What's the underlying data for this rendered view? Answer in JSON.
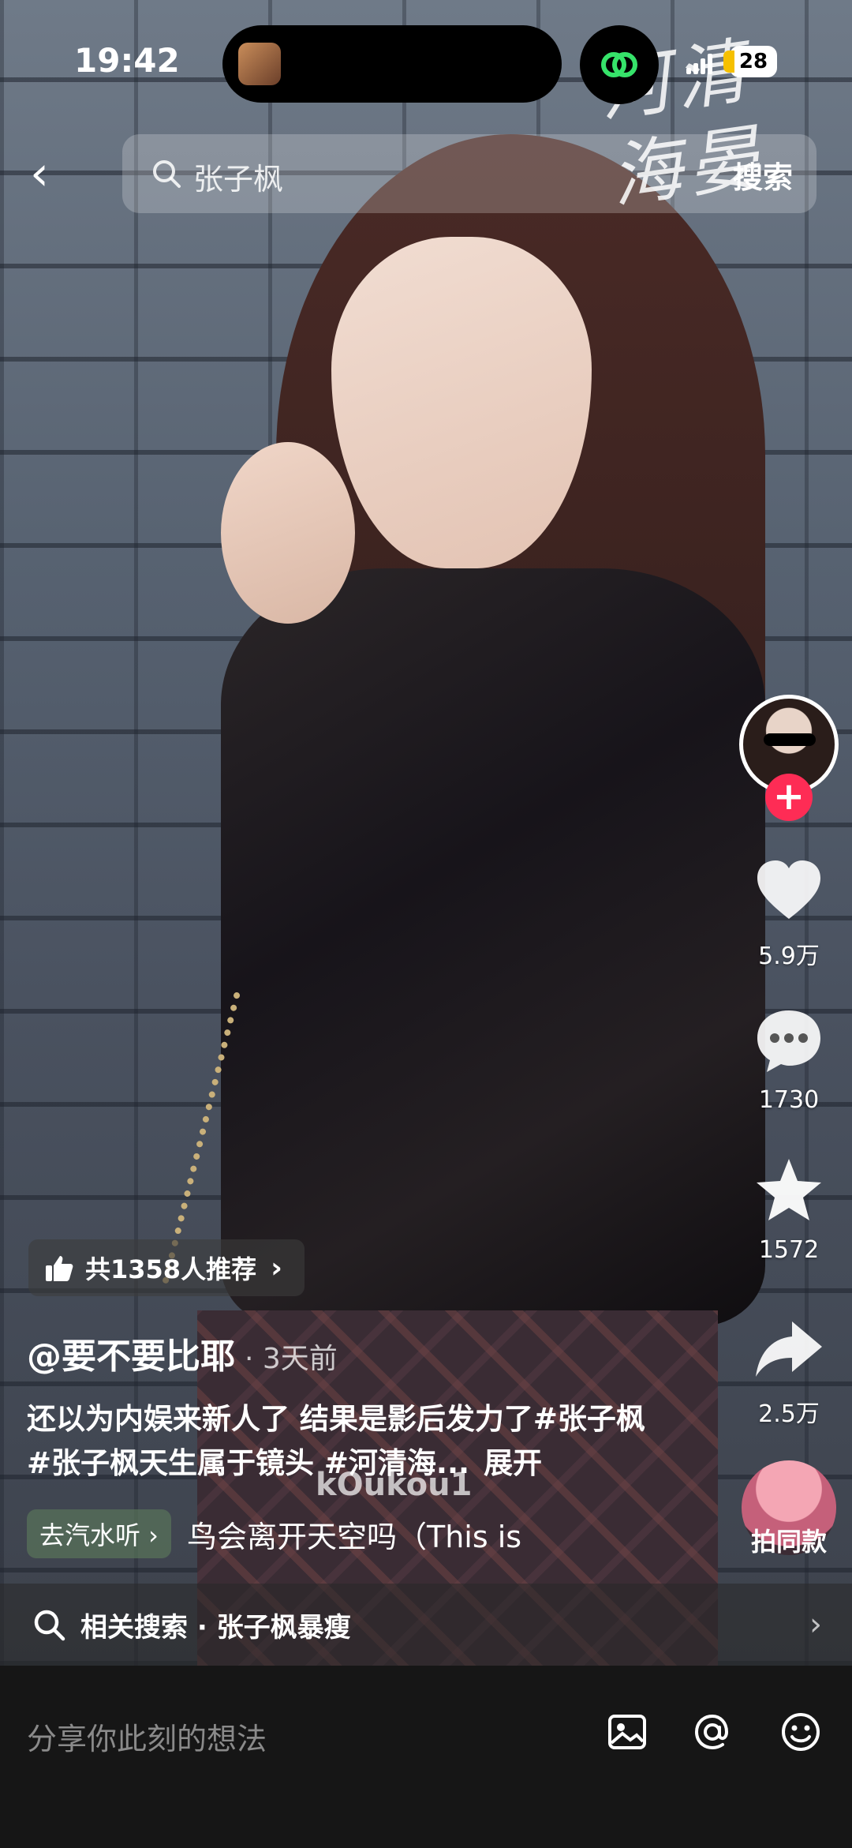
{
  "status_bar": {
    "time": "19:42",
    "battery": "28"
  },
  "search": {
    "query": "张子枫",
    "button_label": "搜索"
  },
  "calligraphy_text": "河清海晏",
  "right_rail": {
    "like_count": "5.9万",
    "comment_count": "1730",
    "favorite_count": "1572",
    "share_count": "2.5万",
    "same_style_label": "拍同款"
  },
  "post": {
    "recommend_text": "共1358人推荐",
    "author": "@要不要比耶",
    "time": "· 3天前",
    "caption": "还以为内娱来新人了 结果是影后发力了#张子枫 #张子枫天生属于镜头 #河清海...",
    "expand_label": "展开",
    "watermark": "kOukou1",
    "music_tag": "去汽水听 ›",
    "music_title": "鸟会离开天空吗（This is"
  },
  "related_search": {
    "label": "相关搜索 · 张子枫暴瘦"
  },
  "comment_bar": {
    "placeholder": "分享你此刻的想法"
  },
  "colors": {
    "accent": "#fe2c55",
    "comment_bar_bg": "#161616"
  }
}
